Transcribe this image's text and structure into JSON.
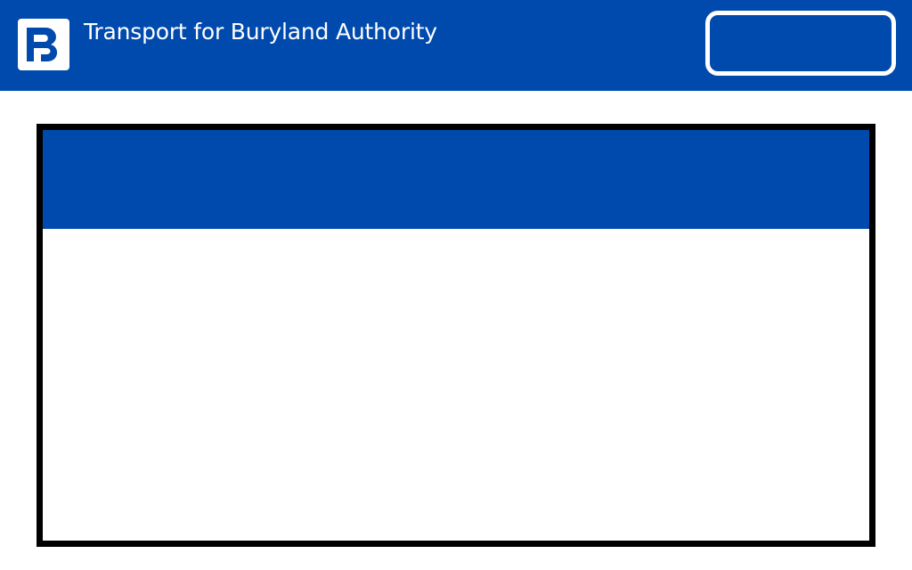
{
  "header": {
    "title": "Transport for Buryland Authority",
    "logo_icon": "tba-monogram-icon",
    "action_button_label": ""
  },
  "panel": {
    "header_text": "",
    "body_text": ""
  },
  "colors": {
    "brand_blue": "#004aad",
    "background": "#ffffff",
    "panel_border": "#000000"
  }
}
